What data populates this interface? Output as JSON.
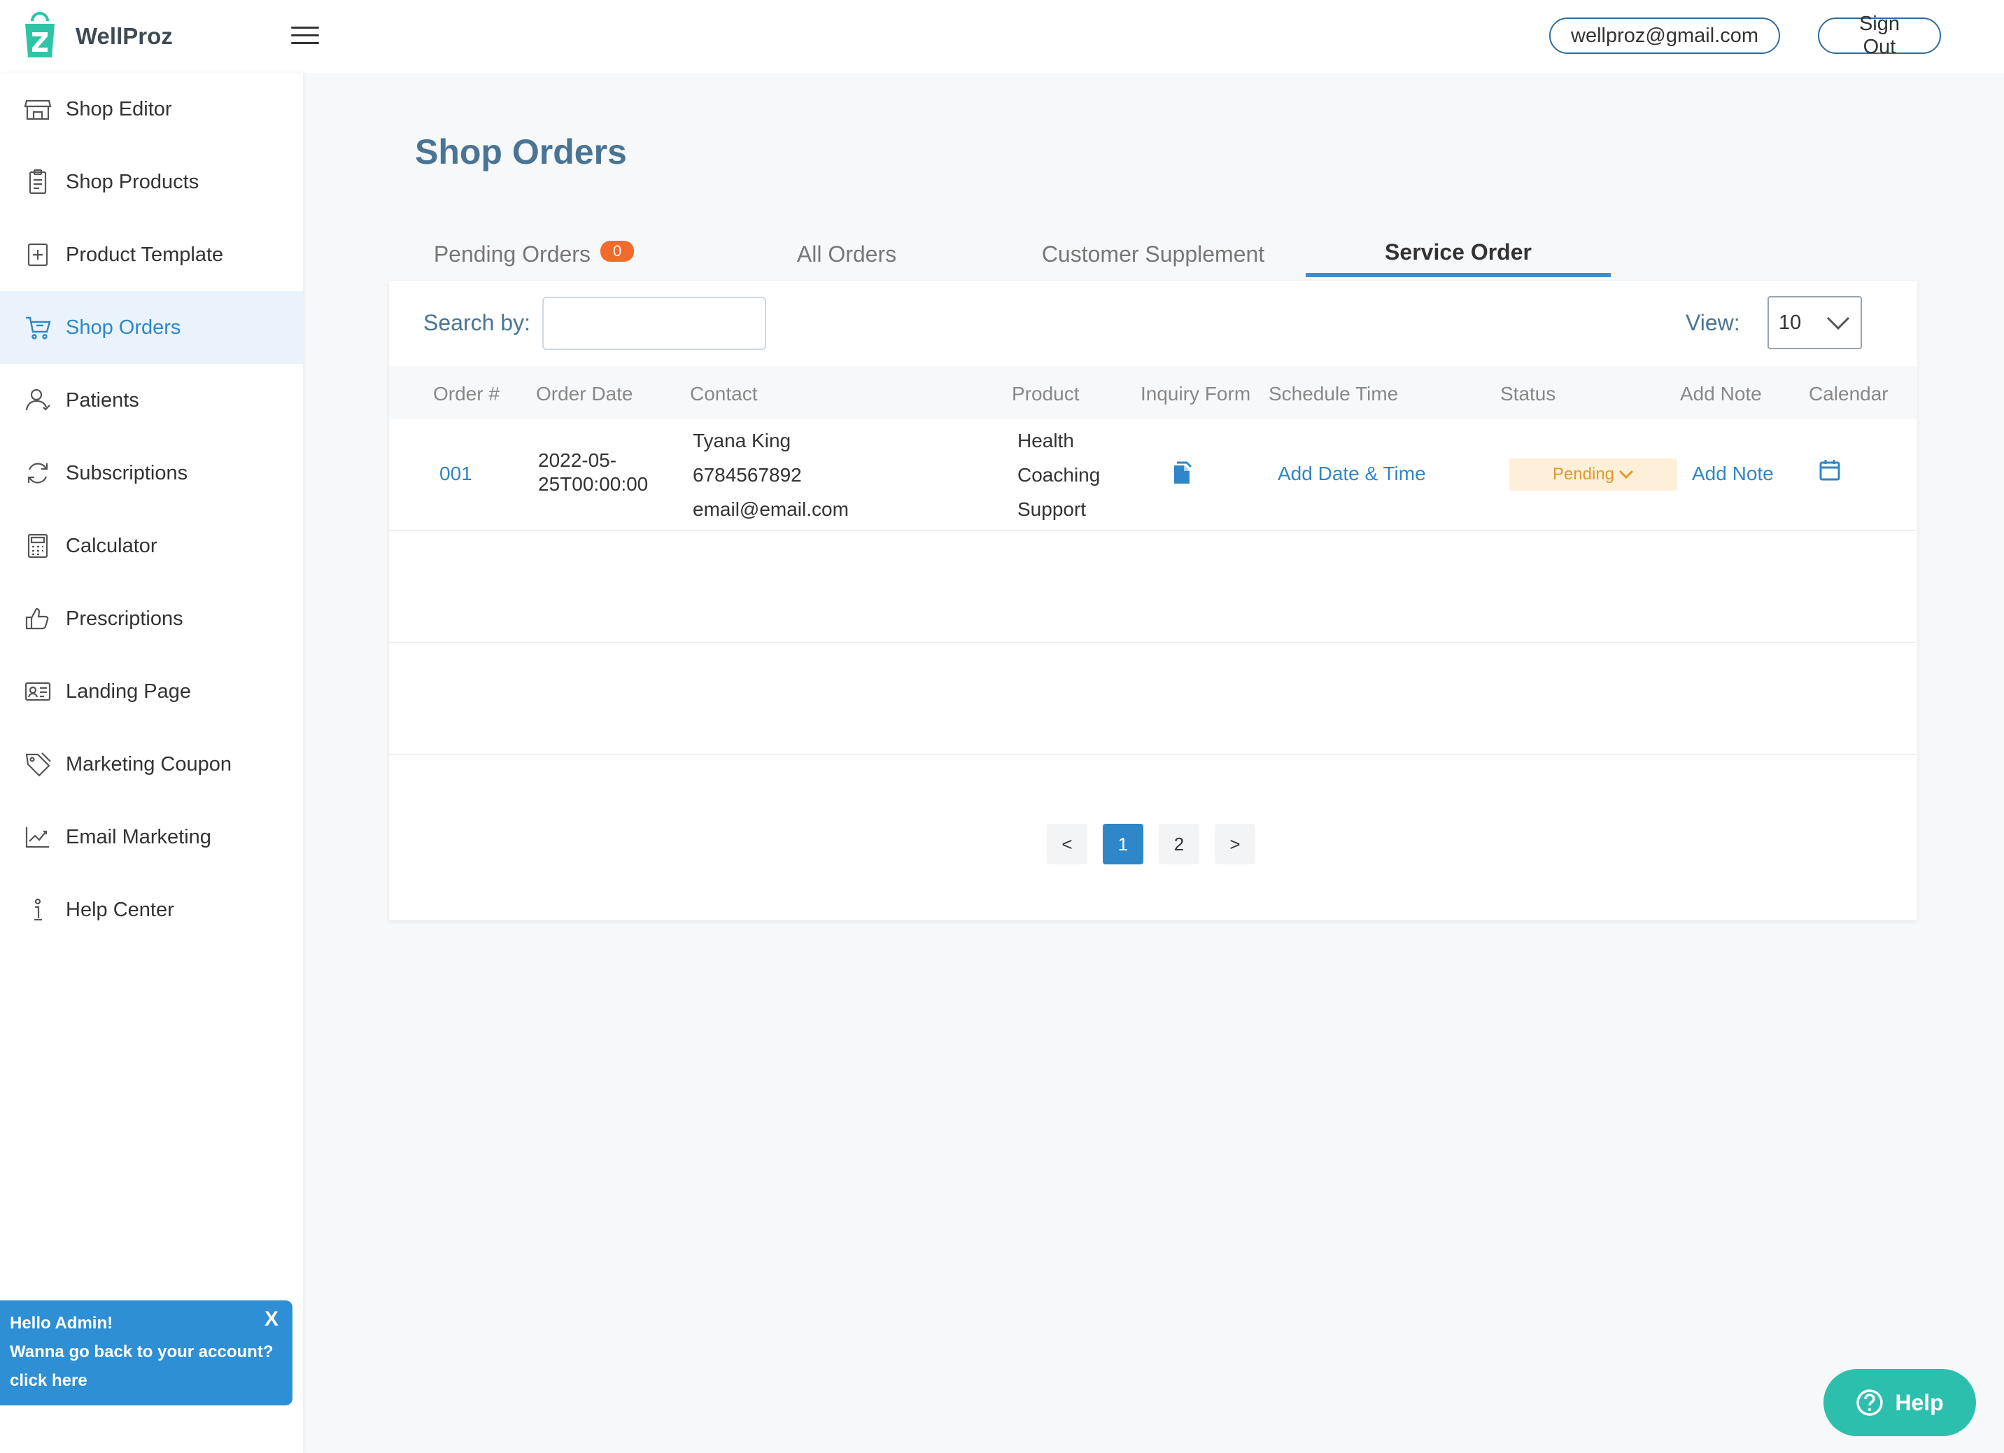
{
  "brand": {
    "name": "WellProz"
  },
  "header": {
    "email": "wellproz@gmail.com",
    "sign_out": "Sign Out"
  },
  "sidebar": {
    "items": [
      {
        "label": "Shop Editor",
        "icon": "storefront-icon"
      },
      {
        "label": "Shop Products",
        "icon": "clipboard-icon"
      },
      {
        "label": "Product Template",
        "icon": "plus-box-icon"
      },
      {
        "label": "Shop Orders",
        "icon": "cart-icon"
      },
      {
        "label": "Patients",
        "icon": "user-icon"
      },
      {
        "label": "Subscriptions",
        "icon": "refresh-icon"
      },
      {
        "label": "Calculator",
        "icon": "calculator-icon"
      },
      {
        "label": "Prescriptions",
        "icon": "thumbs-up-icon"
      },
      {
        "label": "Landing Page",
        "icon": "id-card-icon"
      },
      {
        "label": "Marketing Coupon",
        "icon": "tag-icon"
      },
      {
        "label": "Email Marketing",
        "icon": "line-chart-icon"
      },
      {
        "label": "Help Center",
        "icon": "info-icon"
      }
    ],
    "active_index": 3
  },
  "banner": {
    "line1": "Hello Admin!",
    "line2": "Wanna go back to your account?",
    "line3": "click here",
    "close": "X"
  },
  "main": {
    "title": "Shop Orders",
    "tabs": [
      {
        "label": "Pending Orders",
        "badge": "0"
      },
      {
        "label": "All Orders"
      },
      {
        "label": "Customer Supplement"
      },
      {
        "label": "Service Order"
      }
    ],
    "active_tab": 3,
    "search_label": "Search by:",
    "search_value": "",
    "view_label": "View:",
    "view_value": "10",
    "columns": [
      "Order #",
      "Order Date",
      "Contact",
      "Product",
      "Inquiry Form",
      "Schedule Time",
      "Status",
      "Add Note",
      "Calendar"
    ],
    "rows": [
      {
        "order": "001",
        "date_line1": "2022-05-",
        "date_line2": "25T00:00:00",
        "contact_name": "Tyana King",
        "contact_phone": "6784567892",
        "contact_email": "email@email.com",
        "product_line1": "Health",
        "product_line2": "Coaching",
        "product_line3": "Support",
        "schedule": "Add Date & Time",
        "status": "Pending",
        "add_note": "Add Note"
      }
    ],
    "pagination": {
      "prev": "<",
      "pages": [
        "1",
        "2"
      ],
      "current": "1",
      "next": ">"
    }
  },
  "help_button": {
    "label": "Help"
  },
  "colors": {
    "accent": "#2f86c8",
    "title": "#4a7494",
    "badge": "#f36b2c",
    "status_pending_bg": "#fdefd8",
    "status_pending_text": "#e19a2b",
    "help": "#2dbfae"
  }
}
